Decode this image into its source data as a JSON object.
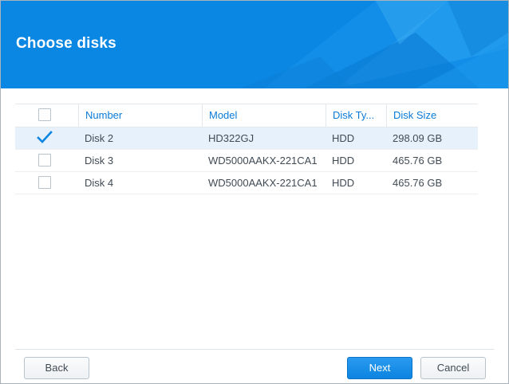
{
  "dialog": {
    "title": "Choose disks"
  },
  "table": {
    "columns": [
      "Number",
      "Model",
      "Disk Ty...",
      "Disk Size"
    ],
    "rows": [
      {
        "number": "Disk 2",
        "model": "HD322GJ",
        "type": "HDD",
        "size": "298.09 GB",
        "checked": true
      },
      {
        "number": "Disk 3",
        "model": "WD5000AAKX-221CA1",
        "type": "HDD",
        "size": "465.76 GB",
        "checked": false
      },
      {
        "number": "Disk 4",
        "model": "WD5000AAKX-221CA1",
        "type": "HDD",
        "size": "465.76 GB",
        "checked": false
      }
    ]
  },
  "buttons": {
    "back": "Back",
    "next": "Next",
    "cancel": "Cancel"
  },
  "colors": {
    "header": "#0a86e3",
    "accent": "#0b7bd6",
    "selected_row": "#e6f1fb",
    "check": "#0b86e3"
  }
}
